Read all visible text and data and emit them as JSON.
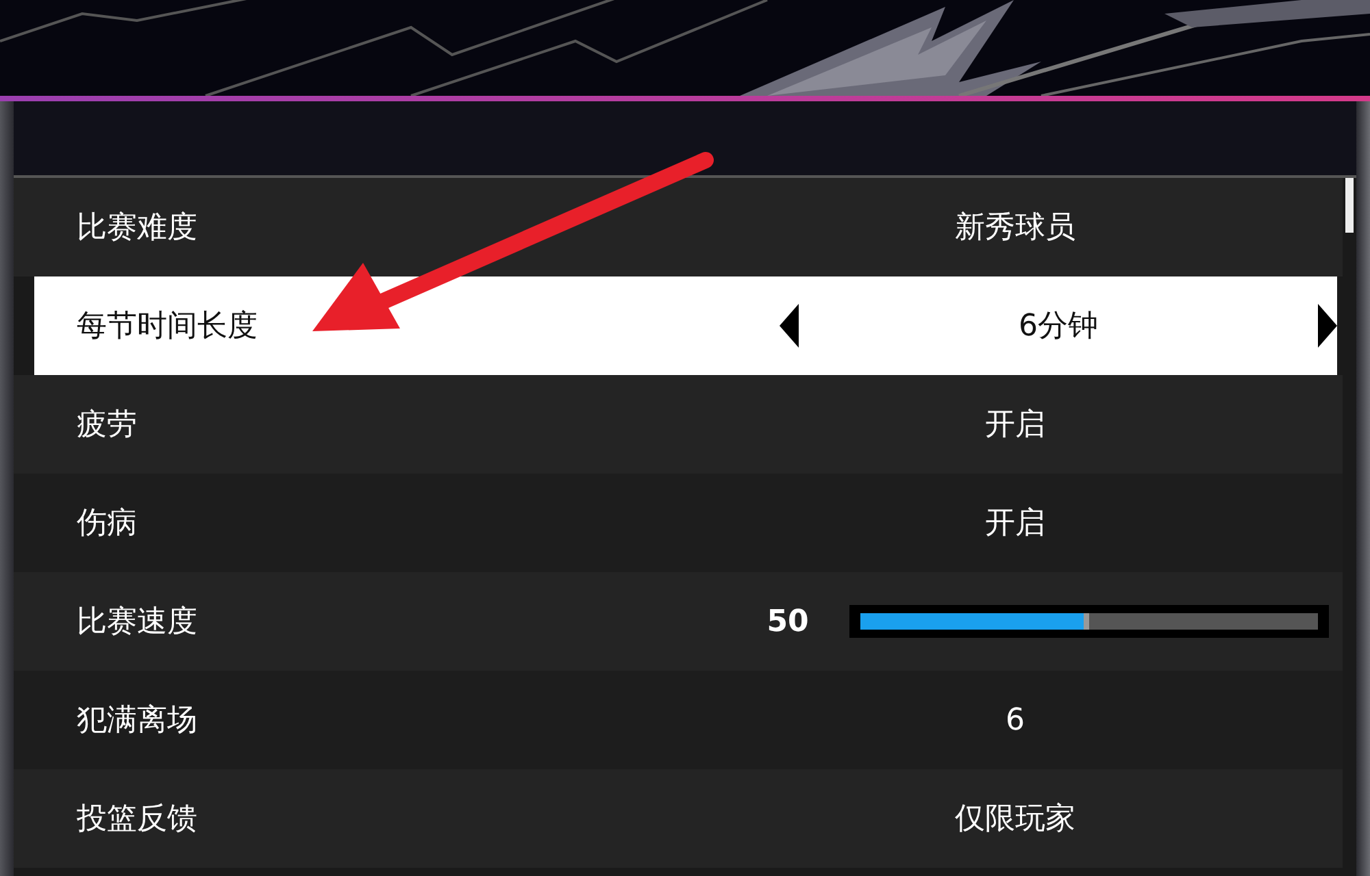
{
  "settings": [
    {
      "kind": "option",
      "label": "比赛难度",
      "value": "新秀球员",
      "selected": false
    },
    {
      "kind": "option",
      "label": "每节时间长度",
      "value": "6分钟",
      "selected": true
    },
    {
      "kind": "option",
      "label": "疲劳",
      "value": "开启",
      "selected": false
    },
    {
      "kind": "option",
      "label": "伤病",
      "value": "开启",
      "selected": false
    },
    {
      "kind": "slider",
      "label": "比赛速度",
      "value": "50",
      "level": 0.5,
      "selected": false
    },
    {
      "kind": "option",
      "label": "犯满离场",
      "value": "6",
      "selected": false
    },
    {
      "kind": "option",
      "label": "投篮反馈",
      "value": "仅限玩家",
      "selected": false
    }
  ]
}
